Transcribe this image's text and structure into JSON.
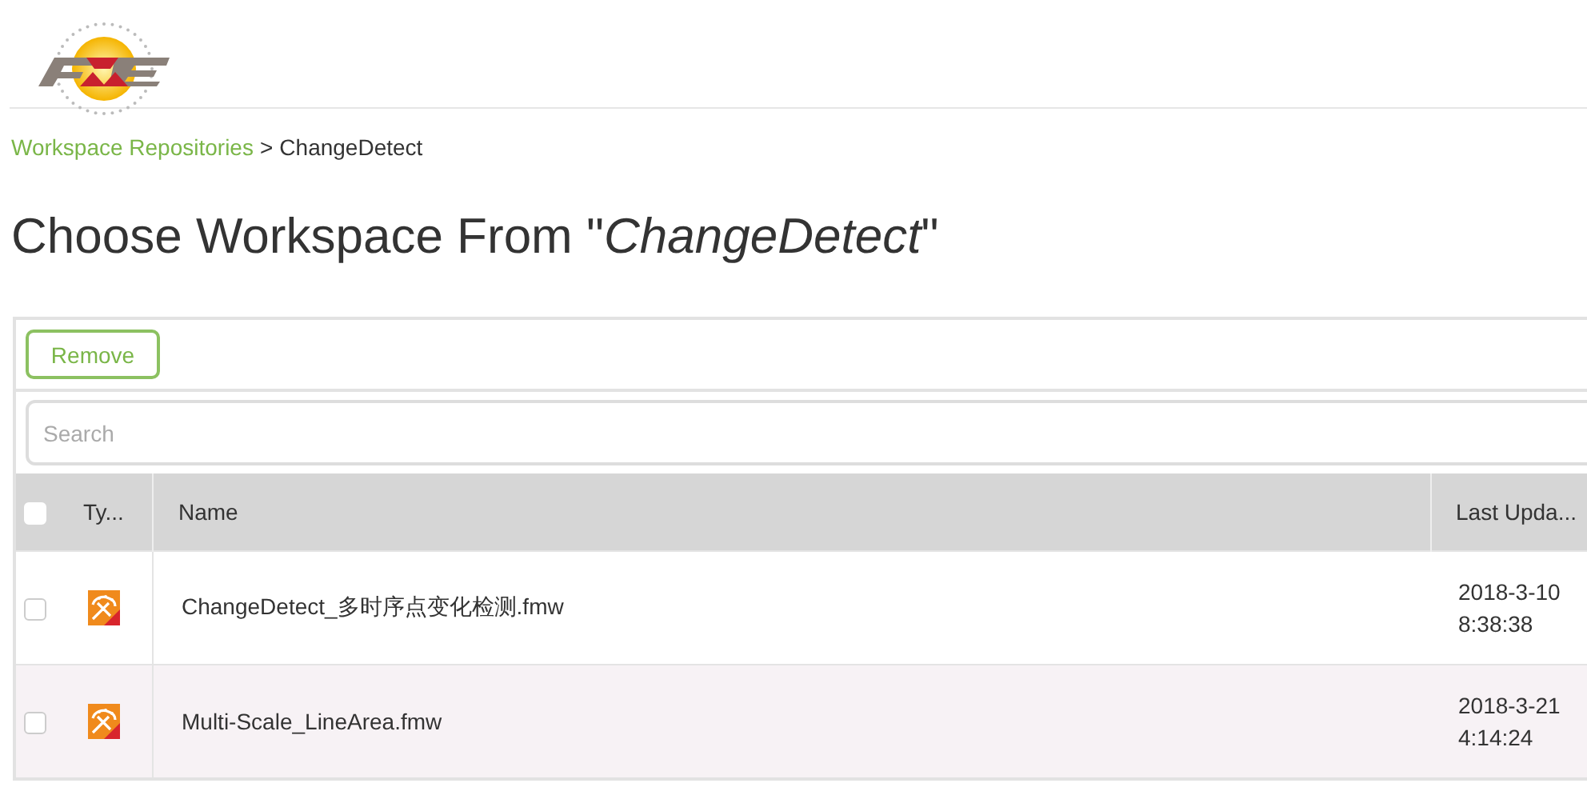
{
  "breadcrumb": {
    "link": "Workspace Repositories",
    "separator": ">",
    "current": "ChangeDetect"
  },
  "title": {
    "prefix": "Choose Workspace From \"",
    "name": "ChangeDetect",
    "suffix": "\""
  },
  "toolbar": {
    "buttons": [
      "Remove"
    ]
  },
  "search": {
    "placeholder": "Search"
  },
  "table": {
    "select_all": {
      "checked": false
    },
    "columns": [
      "Ty...",
      "Name",
      "Last Upda..."
    ],
    "rows": [
      {
        "checked": false,
        "selected": false,
        "name": "ChangeDetect_多时序点变化检测.fmw",
        "updated": "2018-3-10 8:38:38"
      },
      {
        "checked": false,
        "selected": true,
        "name": "Multi-Scale_LineArea.fmw",
        "updated": "2018-3-21 4:14:24"
      }
    ]
  }
}
